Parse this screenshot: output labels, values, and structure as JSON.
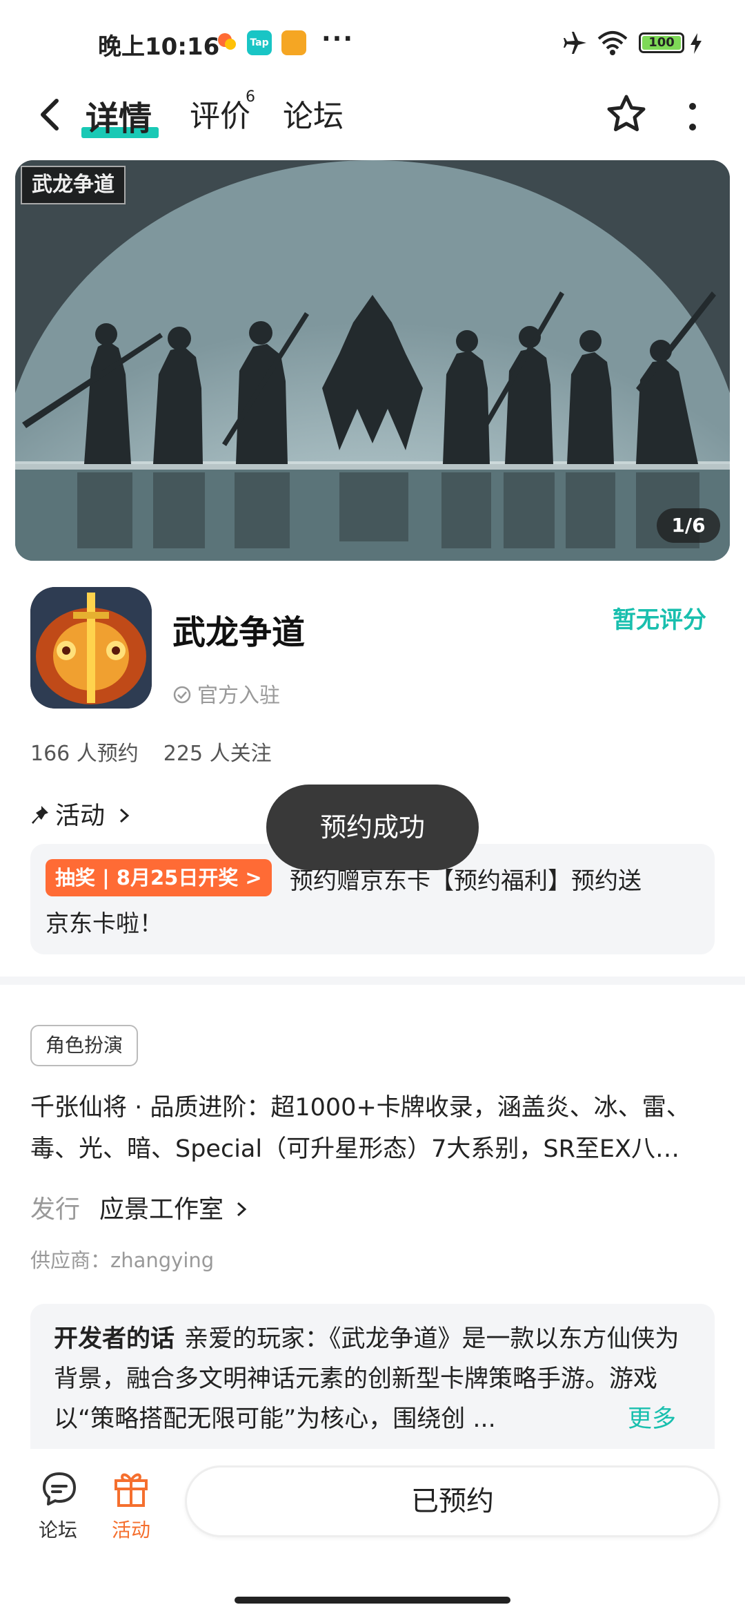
{
  "status_bar": {
    "time": "晚上10:16",
    "tap_label": "Tap",
    "more": "···",
    "battery": "100"
  },
  "nav": {
    "tabs": [
      {
        "label": "详情",
        "active": true
      },
      {
        "label": "评价",
        "badge": "6"
      },
      {
        "label": "论坛"
      }
    ]
  },
  "banner": {
    "logo_text": "武龙争道",
    "counter": "1/6"
  },
  "game": {
    "title": "武龙争道",
    "rating": "暂无评分",
    "official": "官方入驻",
    "reservations": "166 人预约",
    "followers": "225 人关注"
  },
  "activity": {
    "header": "活动",
    "tag": "抽奖 | 8月25日开奖 >",
    "text_line1": "预约赠京东卡【预约福利】预约送",
    "text_line2": "京东卡啦！"
  },
  "toast": "预约成功",
  "details": {
    "tag": "角色扮演",
    "description": "千张仙将 · 品质进阶：超1000+卡牌收录，涵盖炎、冰、雷、毒、光、暗、Special（可升星形态）7大系别，SR至EX八…",
    "publisher_label": "发行",
    "publisher_name": "应景工作室",
    "supplier": "供应商：zhangying"
  },
  "developer_note": {
    "label": "开发者的话",
    "text": "亲爱的玩家：《武龙争道》是一款以东方仙侠为背景，融合多文明神话元素的创新型卡牌策略手游。游戏以“策略搭配无限可能”为核心，围绕创 ...",
    "more": "更多"
  },
  "bottom_bar": {
    "forum_label": "论坛",
    "activity_label": "活动",
    "main_button": "已预约"
  },
  "colors": {
    "accent": "#19bfae",
    "orange": "#ff6b35"
  }
}
